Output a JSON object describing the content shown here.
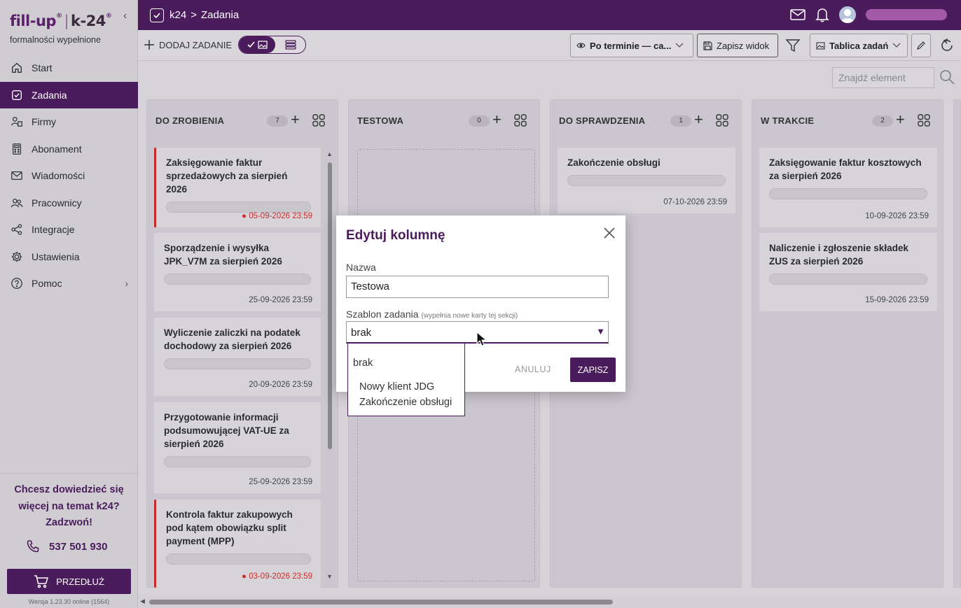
{
  "sidebar": {
    "logo_fill": "fill-up",
    "logo_sep": "|",
    "logo_k24": "k-24",
    "logo_mark": "®",
    "tagline": "formalności wypełnione",
    "items": [
      {
        "label": "Start",
        "icon": "home-icon"
      },
      {
        "label": "Zadania",
        "icon": "check-square-icon",
        "active": true
      },
      {
        "label": "Firmy",
        "icon": "company-icon"
      },
      {
        "label": "Abonament",
        "icon": "calculator-icon"
      },
      {
        "label": "Wiadomości",
        "icon": "mail-icon"
      },
      {
        "label": "Pracownicy",
        "icon": "people-icon"
      },
      {
        "label": "Integracje",
        "icon": "share-icon"
      },
      {
        "label": "Ustawienia",
        "icon": "gear-icon"
      },
      {
        "label": "Pomoc",
        "icon": "help-icon"
      }
    ],
    "promo_line1": "Chcesz dowiedzieć się",
    "promo_line2": "więcej na temat k24?",
    "promo_line3": "Zadzwoń!",
    "phone": "537 501 930",
    "renew_label": "PRZEDŁUŻ",
    "version": "Wersja 1.23.30 online (1564)"
  },
  "topbar": {
    "crumb_root": "k24",
    "crumb_sep": ">",
    "crumb_current": "Zadania"
  },
  "toolbar": {
    "add_task": "DODAJ ZADANIE",
    "sort_label": "Po terminie — ca...",
    "save_view": "Zapisz widok",
    "board_label": "Tablica zadań",
    "search_placeholder": "Znajdź element"
  },
  "columns": [
    {
      "title": "DO ZROBIENIA",
      "count": "7",
      "cards": [
        {
          "title_l1": "Zaksięgowanie faktur",
          "title_l2": "sprzedażowych za sierpień 2026",
          "title_l3": "",
          "date": "05-09-2026 23:59",
          "urgent": true
        },
        {
          "title_l1": "Sporządzenie i wysyłka",
          "title_l2": "JPK_V7M za sierpień 2026",
          "title_l3": "",
          "date": "25-09-2026 23:59",
          "urgent": false
        },
        {
          "title_l1": "Wyliczenie zaliczki na podatek",
          "title_l2": "dochodowy za sierpień 2026",
          "title_l3": "",
          "date": "20-09-2026 23:59",
          "urgent": false
        },
        {
          "title_l1": "Przygotowanie informacji",
          "title_l2": "podsumowującej VAT-UE za",
          "title_l3": "sierpień 2026",
          "date": "25-09-2026 23:59",
          "urgent": false
        },
        {
          "title_l1": "Kontrola faktur zakupowych",
          "title_l2": "pod kątem obowiązku split",
          "title_l3": "payment (MPP)",
          "date": "03-09-2026 23:59",
          "urgent": true
        }
      ]
    },
    {
      "title": "TESTOWA",
      "count": "0",
      "cards": []
    },
    {
      "title": "DO SPRAWDZENIA",
      "count": "1",
      "cards": [
        {
          "title_l1": "Zakończenie obsługi",
          "title_l2": "",
          "title_l3": "",
          "date": "07-10-2026 23:59",
          "urgent": false
        }
      ]
    },
    {
      "title": "W TRAKCIE",
      "count": "2",
      "cards": [
        {
          "title_l1": "Zaksięgowanie faktur kosztowych",
          "title_l2": "za sierpień 2026",
          "title_l3": "",
          "date": "10-09-2026 23:59",
          "urgent": false
        },
        {
          "title_l1": "Naliczenie i zgłoszenie składek",
          "title_l2": "ZUS za sierpień 2026",
          "title_l3": "",
          "date": "15-09-2026 23:59",
          "urgent": false
        }
      ]
    }
  ],
  "modal": {
    "title": "Edytuj kolumnę",
    "name_label": "Nazwa",
    "name_value": "Testowa",
    "template_label": "Szablon zadania",
    "template_hint": "(wypełnia nowe karty tej sekcji)",
    "template_value": "brak",
    "cancel": "ANULUJ",
    "save": "ZAPISZ",
    "options": [
      "brak",
      "Nowy klient JDG",
      "Zakończenie obsługi"
    ]
  },
  "colors": {
    "brand": "#4b1c5c",
    "urgent": "#c92c2c"
  }
}
